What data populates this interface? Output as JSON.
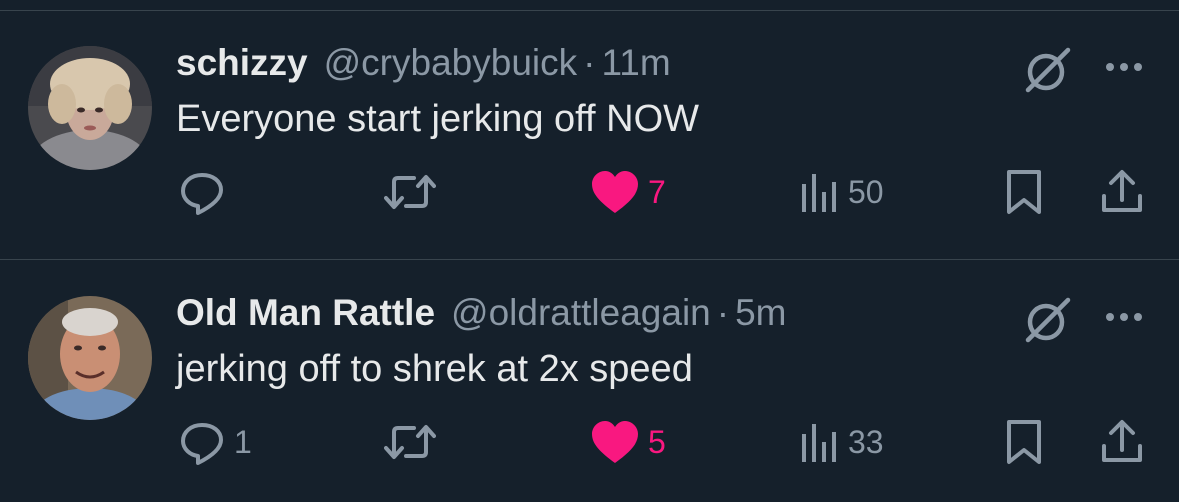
{
  "tweets": [
    {
      "display_name": "schizzy",
      "handle": "@crybabybuick",
      "separator": "·",
      "time": "11m",
      "text": "Everyone start jerking off NOW",
      "reply_count": "",
      "retweet_count": "",
      "like_count": "7",
      "view_count": "50",
      "liked": true
    },
    {
      "display_name": "Old Man Rattle",
      "handle": "@oldrattleagain",
      "separator": "·",
      "time": "5m",
      "text": "jerking off to shrek at 2x speed",
      "reply_count": "1",
      "retweet_count": "",
      "like_count": "5",
      "view_count": "33",
      "liked": true
    }
  ],
  "colors": {
    "background": "#15202b",
    "primary_text": "#e7e9ea",
    "secondary_text": "#8b98a5",
    "like": "#f91880",
    "divider": "#38444d"
  },
  "icons": {
    "reply": "reply-icon",
    "retweet": "retweet-icon",
    "like": "heart-icon",
    "views": "views-icon",
    "bookmark": "bookmark-icon",
    "share": "share-icon",
    "grok": "grok-icon",
    "more": "more-icon"
  }
}
